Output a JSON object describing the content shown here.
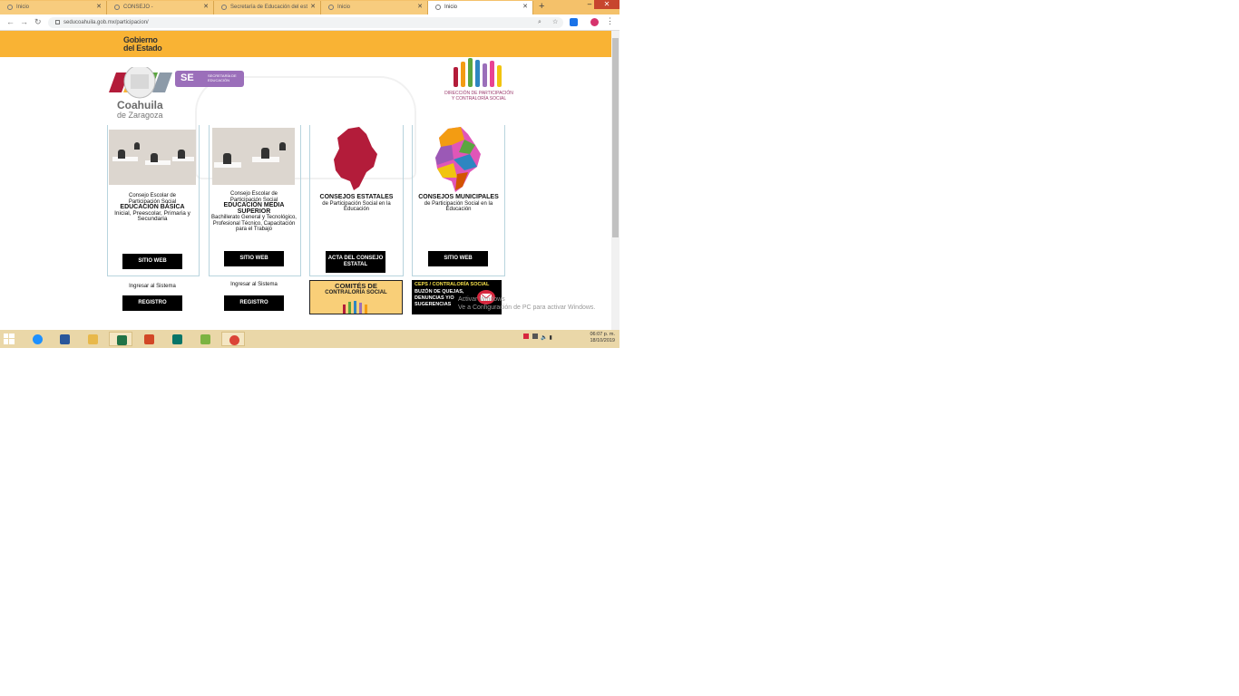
{
  "browser": {
    "tabs": [
      {
        "label": "Inicio",
        "active": false
      },
      {
        "label": "CONSEJO -",
        "active": false
      },
      {
        "label": "Secretaría de Educación del est",
        "active": false
      },
      {
        "label": "Inicio",
        "active": false
      },
      {
        "label": "Inicio",
        "active": true
      }
    ],
    "new_tab": "+",
    "url": "seducoahuila.gob.mx/participacion/",
    "window_controls": {
      "minimize": "–",
      "maximize": "□",
      "close": "✕"
    },
    "menu": "⋮",
    "profile_initial": "o"
  },
  "header": {
    "gobierno_line1": "Gobierno",
    "gobierno_line2": "del Estado",
    "coahuila": "Coahuila",
    "zaragoza": "de Zaragoza",
    "se_badge": "SE",
    "se_sub": "SECRETARÍA DE EDUCACIÓN",
    "direccion_line1": "DIRECCIÓN DE PARTICIPACIÓN",
    "direccion_line2": "Y CONTRALORÍA SOCIAL"
  },
  "cards": [
    {
      "line1": "Consejo Escolar de",
      "line2": "Participación Social",
      "title": "EDUCACIÓN BÁSICA",
      "sub": "Inicial, Preescolar, Primaria y Secundaria",
      "button": "SITIO WEB",
      "ingresar": "Ingresar al Sistema",
      "registro": "REGISTRO"
    },
    {
      "line1": "Consejo Escolar de",
      "line2": "Participación Social",
      "title": "EDUCACIÓN MEDIA SUPERIOR",
      "sub": "Bachillerato General y Tecnológico, Profesional Técnico, Capacitación para el Trabajo",
      "button": "SITIO WEB",
      "ingresar": "Ingresar al Sistema",
      "registro": "REGISTRO"
    },
    {
      "title": "CONSEJOS ESTATALES",
      "sub": "de Participación Social en la Educación",
      "button": "ACTA DEL CONSEJO ESTATAL"
    },
    {
      "title": "CONSEJOS MUNICIPALES",
      "sub": "de Participación Social en la Educación",
      "button": "SITIO WEB"
    }
  ],
  "comites": {
    "title": "COMITÉS DE",
    "sub": "CONTRALORÍA SOCIAL"
  },
  "buzon": {
    "top": "CEPS / CONTRALORÍA SOCIAL",
    "body": "BUZÓN DE QUEJAS, DENUNCIAS Y/O SUGERENCIAS"
  },
  "activate_windows": {
    "line1": "Activar Windows",
    "line2": "Ve a Configuración de PC para activar Windows."
  },
  "taskbar": {
    "apps": [
      "internet-explorer",
      "word",
      "file-explorer",
      "excel",
      "powerpoint",
      "publisher",
      "notepad",
      "chrome"
    ],
    "clock_time": "06:07 p. m.",
    "clock_date": "18/10/2019"
  },
  "colors": {
    "header_band": "#f9b334",
    "tab_strip": "#f4c16a",
    "se_purple": "#9b6fba",
    "button_black": "#000000",
    "comites_bg": "#f9cf78",
    "map_red": "#b31c3a"
  }
}
